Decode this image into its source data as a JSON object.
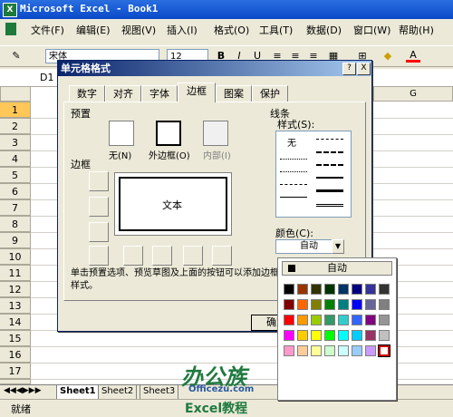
{
  "window": {
    "title": "Microsoft Excel - Book1"
  },
  "menu": [
    "文件(F)",
    "编辑(E)",
    "视图(V)",
    "插入(I)",
    "格式(O)",
    "工具(T)",
    "数据(D)",
    "窗口(W)",
    "帮助(H)"
  ],
  "toolbar": {
    "font": "宋体",
    "size": "12",
    "bold": "B",
    "italic": "I",
    "underline": "U",
    "font_color_letter": "A"
  },
  "formula_bar": {
    "cell_ref": "D1"
  },
  "grid": {
    "col_g": "G",
    "rows": [
      "1",
      "2",
      "3",
      "4",
      "5",
      "6",
      "7",
      "8",
      "9",
      "10",
      "11",
      "12",
      "13",
      "14",
      "15",
      "16",
      "17",
      "18",
      "19"
    ]
  },
  "sheet_tabs": [
    "Sheet1",
    "Sheet2",
    "Sheet3"
  ],
  "status": "就绪",
  "dialog": {
    "title": "单元格格式",
    "help_btn": "?",
    "close_btn": "X",
    "tabs": [
      "数字",
      "对齐",
      "字体",
      "边框",
      "图案",
      "保护"
    ],
    "active_tab": "边框",
    "preset_label": "预置",
    "presets": [
      "无(N)",
      "外边框(O)",
      "内部(I)"
    ],
    "border_label": "边框",
    "preview_text": "文本",
    "line_label": "线条",
    "style_label": "样式(S):",
    "style_none": "无",
    "color_label": "颜色(C):",
    "color_value": "自动",
    "hint": "单击预置选项、预览草图及上面的按钮可以添加边框样式。",
    "ok": "确定"
  },
  "color_dropdown": {
    "auto": "自动",
    "colors": [
      [
        "#000000",
        "#993300",
        "#333300",
        "#003300",
        "#003366",
        "#000080",
        "#333399",
        "#333333"
      ],
      [
        "#800000",
        "#ff6600",
        "#808000",
        "#008000",
        "#008080",
        "#0000ff",
        "#666699",
        "#808080"
      ],
      [
        "#ff0000",
        "#ff9900",
        "#99cc00",
        "#339966",
        "#33cccc",
        "#3366ff",
        "#800080",
        "#969696"
      ],
      [
        "#ff00ff",
        "#ffcc00",
        "#ffff00",
        "#00ff00",
        "#00ffff",
        "#00ccff",
        "#993366",
        "#c0c0c0"
      ],
      [
        "#ff99cc",
        "#ffcc99",
        "#ffff99",
        "#ccffcc",
        "#ccffff",
        "#99ccff",
        "#cc99ff",
        "#ffffff"
      ]
    ],
    "selected_color": "#ffffff"
  },
  "watermark": {
    "brand": "办公族",
    "site": "Officezu.com",
    "footer": "Excel教程"
  }
}
